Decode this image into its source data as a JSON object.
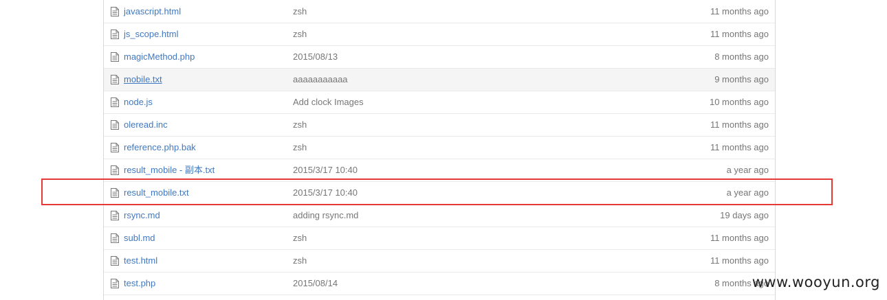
{
  "files": [
    {
      "name": "javascript.html",
      "message": "zsh",
      "age": "11 months ago"
    },
    {
      "name": "js_scope.html",
      "message": "zsh",
      "age": "11 months ago"
    },
    {
      "name": "magicMethod.php",
      "message": "2015/08/13",
      "age": "8 months ago"
    },
    {
      "name": "mobile.txt",
      "message": "aaaaaaaaaaa",
      "age": "9 months ago"
    },
    {
      "name": "node.js",
      "message": "Add clock Images",
      "age": "10 months ago"
    },
    {
      "name": "oleread.inc",
      "message": "zsh",
      "age": "11 months ago"
    },
    {
      "name": "reference.php.bak",
      "message": "zsh",
      "age": "11 months ago"
    },
    {
      "name": "result_mobile - 副本.txt",
      "message": "2015/3/17 10:40",
      "age": "a year ago"
    },
    {
      "name": "result_mobile.txt",
      "message": "2015/3/17 10:40",
      "age": "a year ago"
    },
    {
      "name": "rsync.md",
      "message": "adding rsync.md",
      "age": "19 days ago"
    },
    {
      "name": "subl.md",
      "message": "zsh",
      "age": "11 months ago"
    },
    {
      "name": "test.html",
      "message": "zsh",
      "age": "11 months ago"
    },
    {
      "name": "test.php",
      "message": "2015/08/14",
      "age": "8 months ago"
    }
  ],
  "icons": {
    "file": "file-text-icon"
  },
  "colors": {
    "link": "#4078c0",
    "muted": "#767676",
    "highlight": "#e53935",
    "hover_row": "#f5f5f5"
  },
  "watermark": "www.wooyun.org"
}
